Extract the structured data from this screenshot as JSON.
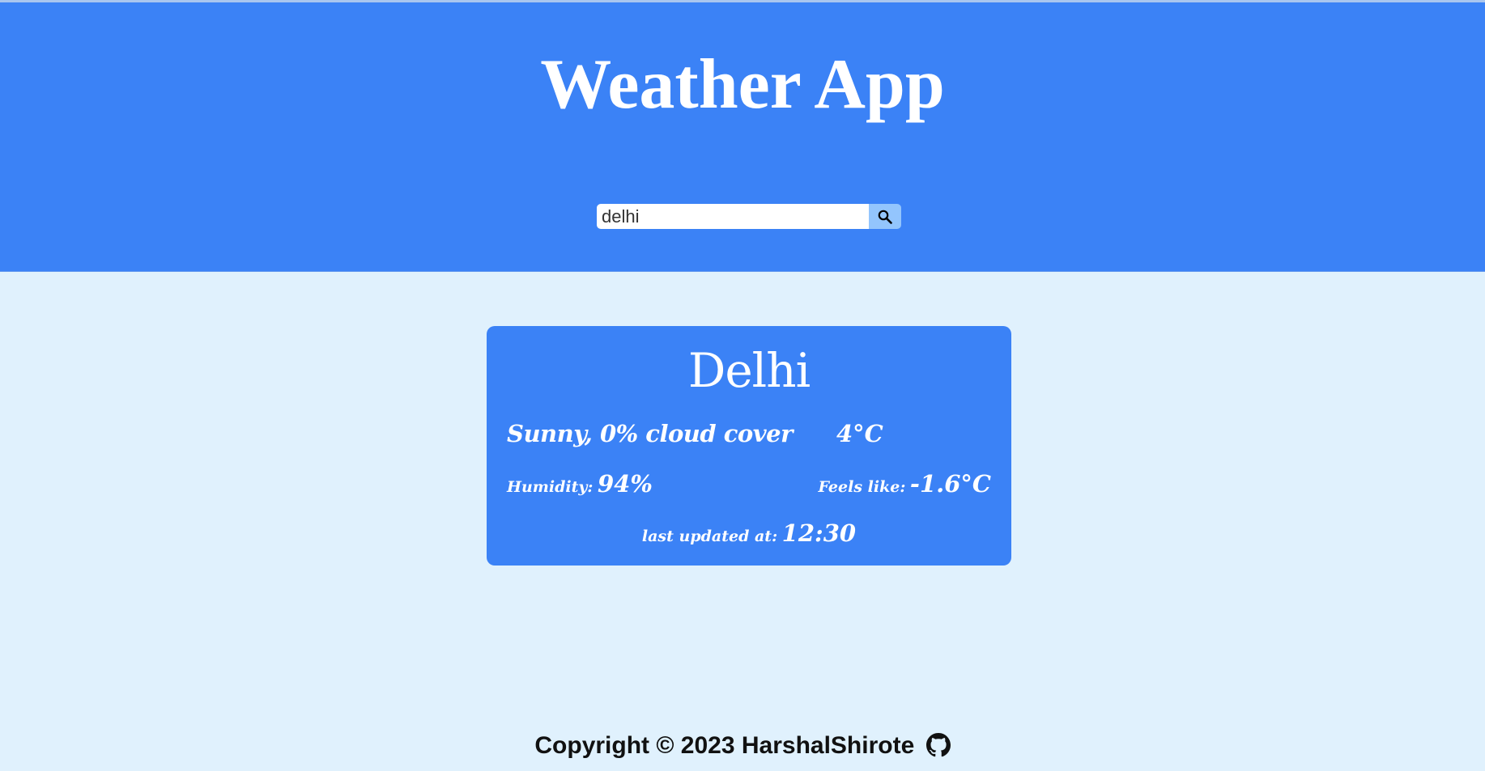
{
  "header": {
    "title": "Weather App"
  },
  "search": {
    "value": "delhi",
    "placeholder": "delhi",
    "button_icon": "search-icon"
  },
  "weather": {
    "city": "Delhi",
    "condition": "Sunny, 0% cloud cover",
    "temperature": "4°C",
    "humidity_label": "Humidity:",
    "humidity_value": "94%",
    "feels_like_label": "Feels like:",
    "feels_like_value": "-1.6°C",
    "updated_label": "last updated at:",
    "updated_value": "12:30"
  },
  "footer": {
    "copyright": "Copyright © 2023 HarshalShirote",
    "icon": "github-icon"
  },
  "colors": {
    "header_bg": "#3b82f6",
    "page_bg": "#e0f1fd",
    "card_bg": "#3b82f6",
    "search_button_bg": "#93c5fd"
  }
}
